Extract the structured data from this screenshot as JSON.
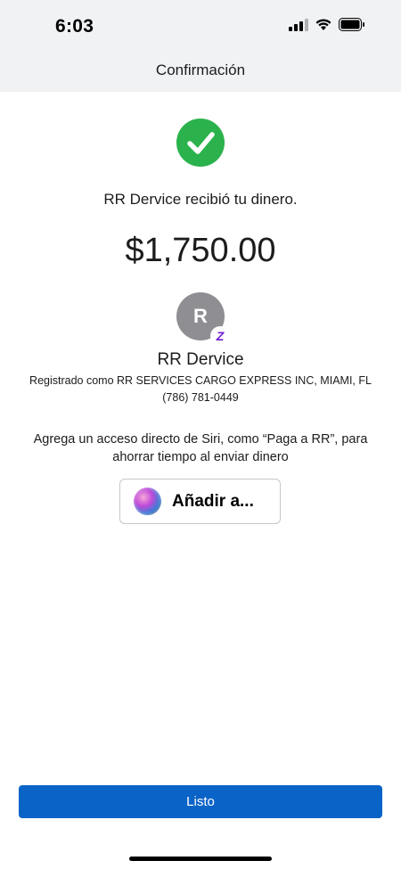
{
  "status_bar": {
    "time": "6:03",
    "icons": [
      "signal-icon",
      "wifi-icon",
      "battery-icon"
    ]
  },
  "nav": {
    "title": "Confirmación"
  },
  "confirmation": {
    "icon": "check-circle-icon",
    "message": "RR Dervice recibió tu dinero.",
    "amount": "$1,750.00"
  },
  "recipient": {
    "avatar_initial": "R",
    "badge": "Z",
    "name": "RR Dervice",
    "registered_as": "Registrado como RR SERVICES CARGO EXPRESS INC, MIAMI, FL",
    "phone": "(786) 781-0449"
  },
  "siri": {
    "prompt": "Agrega un acceso directo de Siri, como “Paga a RR”, para ahorrar tiempo al enviar dinero",
    "button_label": "Añadir a..."
  },
  "footer": {
    "done_label": "Listo"
  },
  "colors": {
    "accent": "#0a63c7",
    "success": "#2bb24c",
    "zelle": "#6d1ed4"
  }
}
